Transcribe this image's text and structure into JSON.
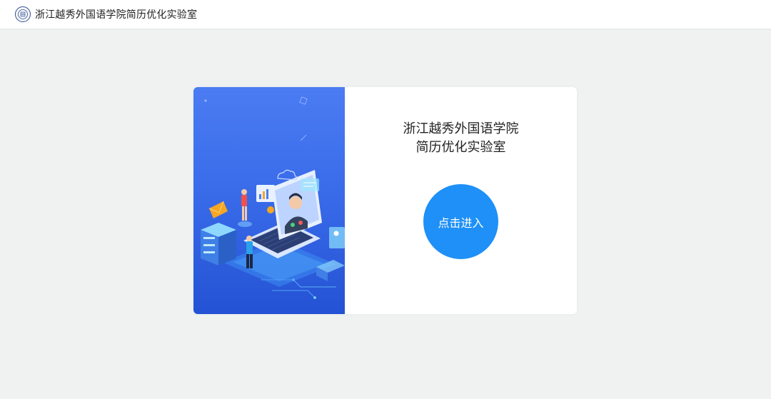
{
  "header": {
    "logo_icon": "university-seal-icon",
    "title": "浙江越秀外国语学院简历优化实验室"
  },
  "card": {
    "illustration_icon": "video-interview-illustration",
    "title_line1": "浙江越秀外国语学院",
    "title_line2": "简历优化实验室",
    "enter_label": "点击进入"
  },
  "colors": {
    "page_bg": "#eff2f1",
    "button": "#1e90f7",
    "illustration_top": "#4b7cf2",
    "illustration_bottom": "#2452d4"
  }
}
